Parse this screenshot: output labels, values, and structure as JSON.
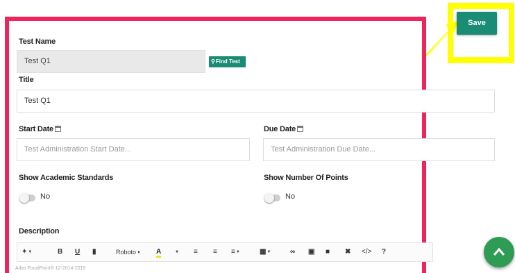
{
  "form": {
    "test_name_label": "Test Name",
    "test_name_value": "Test Q1",
    "find_test_label": "Find Test",
    "title_label": "Title",
    "title_value": "Test Q1",
    "start_date_label": "Start Date",
    "start_date_placeholder": "Test Administration Start Date...",
    "due_date_label": "Due Date",
    "due_date_placeholder": "Test Administration Due Date...",
    "show_standards_label": "Show Academic Standards",
    "show_standards_value": "No",
    "show_points_label": "Show Number Of Points",
    "show_points_value": "No",
    "description_label": "Description"
  },
  "toolbar": {
    "font_name": "Roboto",
    "bold": "B",
    "underline": "U",
    "help": "?",
    "highlight_letter": "A",
    "highlight_color": "#f5e31c"
  },
  "header": {
    "save_label": "Save"
  },
  "footer": {
    "text": "Atlas FocalPoint® 12-2014-2019"
  },
  "colors": {
    "accent": "#1a8b74",
    "frame": "#f0245a",
    "callout": "#ffff00",
    "fab": "#2e9c54"
  }
}
